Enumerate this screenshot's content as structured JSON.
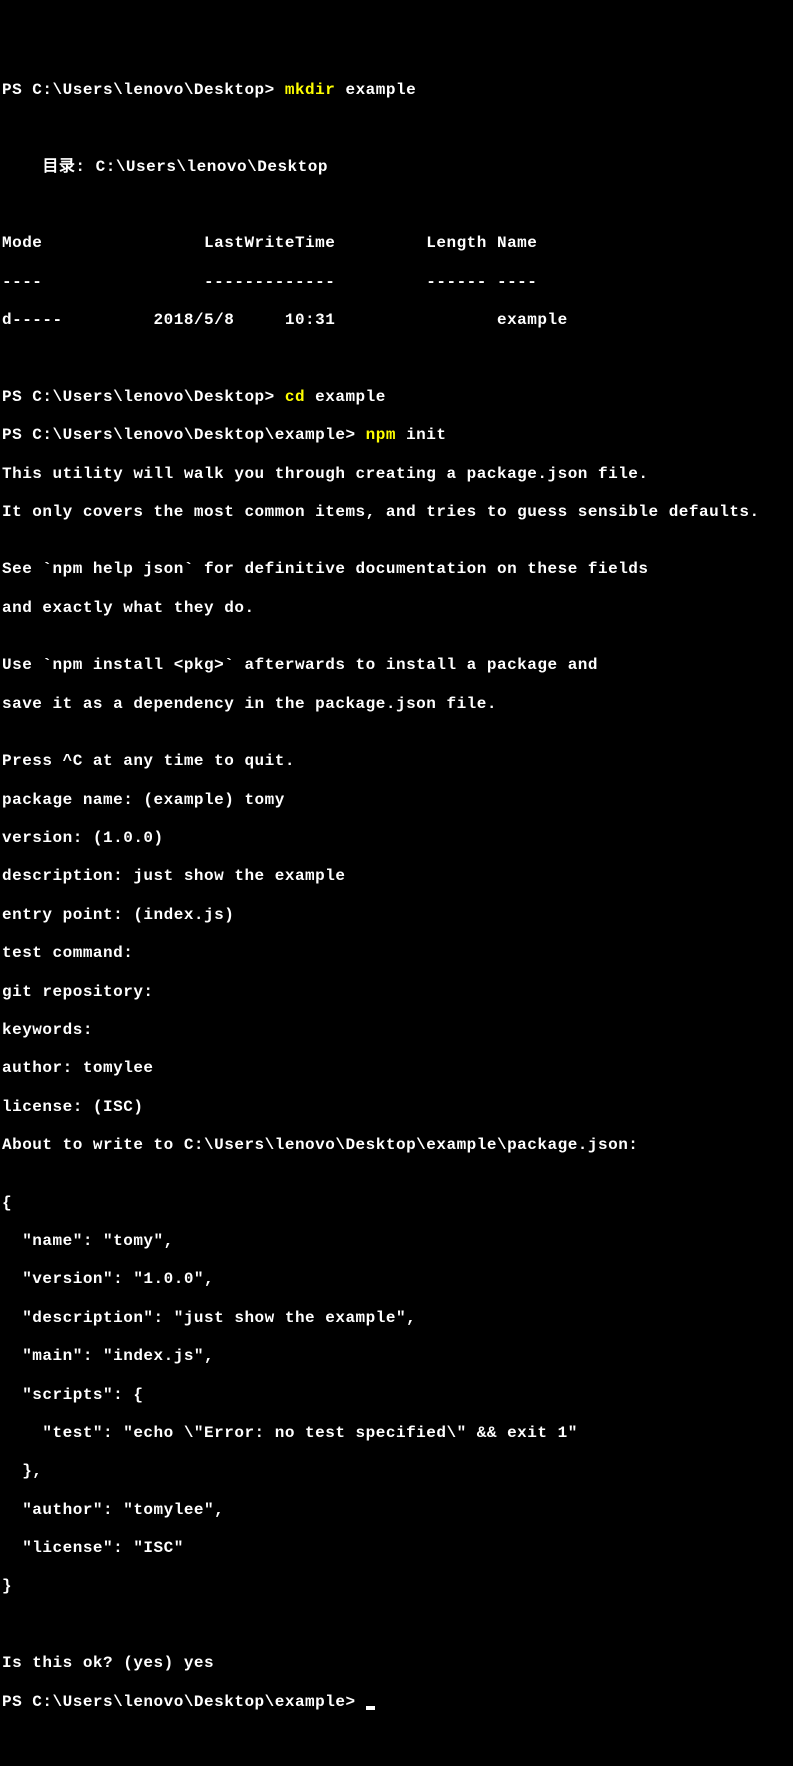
{
  "l0_prompt": "PS C:\\Users\\lenovo\\Desktop> ",
  "l0_cmd": "mkdir",
  "l0_arg": " example",
  "blank": "",
  "dir_line": "    目录: C:\\Users\\lenovo\\Desktop",
  "hdr": "Mode                LastWriteTime         Length Name",
  "hdr_div": "----                -------------         ------ ----",
  "row": "d-----         2018/5/8     10:31                example",
  "l1_prompt": "PS C:\\Users\\lenovo\\Desktop> ",
  "l1_cmd": "cd",
  "l1_arg": " example",
  "l2_prompt": "PS C:\\Users\\lenovo\\Desktop\\example> ",
  "l2_cmd": "npm",
  "l2_arg": " init",
  "t0": "This utility will walk you through creating a package.json file.",
  "t1": "It only covers the most common items, and tries to guess sensible defaults.",
  "t2": "See `npm help json` for definitive documentation on these fields",
  "t3": "and exactly what they do.",
  "t4": "Use `npm install <pkg>` afterwards to install a package and",
  "t5": "save it as a dependency in the package.json file.",
  "t6": "Press ^C at any time to quit.",
  "t7": "package name: (example) tomy",
  "t8": "version: (1.0.0)",
  "t9": "description: just show the example",
  "t10": "entry point: (index.js)",
  "t11": "test command:",
  "t12": "git repository:",
  "t13": "keywords:",
  "t14": "author: tomylee",
  "t15": "license: (ISC)",
  "t16": "About to write to C:\\Users\\lenovo\\Desktop\\example\\package.json:",
  "j0": "{",
  "j1": "  \"name\": \"tomy\",",
  "j2": "  \"version\": \"1.0.0\",",
  "j3": "  \"description\": \"just show the example\",",
  "j4": "  \"main\": \"index.js\",",
  "j5": "  \"scripts\": {",
  "j6": "    \"test\": \"echo \\\"Error: no test specified\\\" && exit 1\"",
  "j7": "  },",
  "j8": "  \"author\": \"tomylee\",",
  "j9": "  \"license\": \"ISC\"",
  "j10": "}",
  "ok": "Is this ok? (yes) yes",
  "l3_prompt": "PS C:\\Users\\lenovo\\Desktop\\example> "
}
